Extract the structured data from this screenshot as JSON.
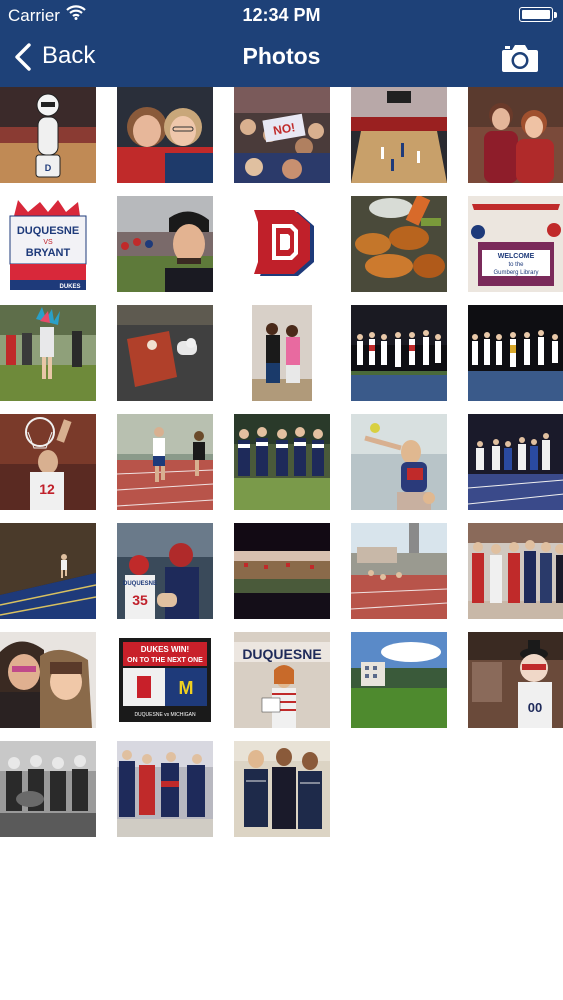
{
  "status_bar": {
    "carrier": "Carrier",
    "time": "12:34 PM"
  },
  "nav": {
    "back_label": "Back",
    "title": "Photos"
  },
  "icons": {
    "back": "chevron-left-icon",
    "camera": "camera-icon",
    "wifi": "wifi-icon",
    "battery": "battery-icon"
  },
  "colors": {
    "nav_bar": "#1e4178",
    "background": "#ffffff"
  },
  "photos": {
    "r1c1": {
      "caption": ""
    },
    "r2c1": {
      "title": "DUQUESNE",
      "vs": "VS",
      "opponent": "BRYANT",
      "footer": "DUKES"
    },
    "r2c5": {
      "sign_line1": "WELCOME",
      "sign_line2": "to the",
      "sign_line3": "Gumberg Library"
    },
    "r5c2": {
      "jersey": "DUQUESNE",
      "number": "35"
    },
    "r6c2": {
      "headline1": "DUKES WIN!",
      "headline2": "ON TO THE NEXT ONE",
      "footer": "DUQUESNE vs MICHIGAN"
    },
    "r6c3": {
      "banner": "DUQUESNE"
    },
    "r6c5": {
      "number": "00"
    }
  }
}
